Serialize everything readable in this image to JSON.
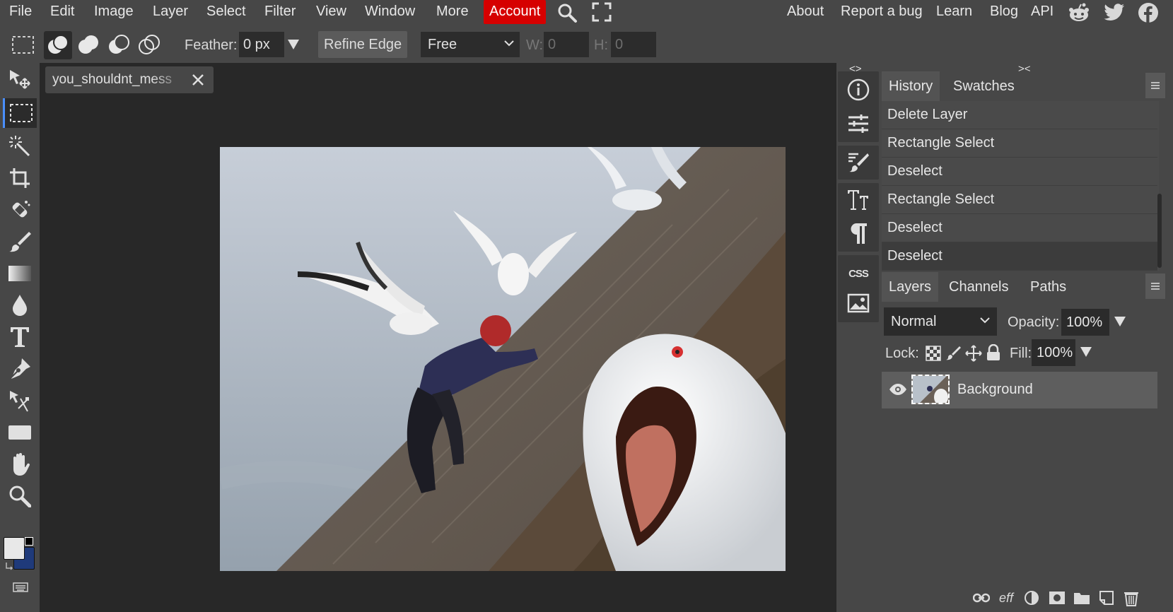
{
  "menu": {
    "items": [
      "File",
      "Edit",
      "Image",
      "Layer",
      "Select",
      "Filter",
      "View",
      "Window",
      "More"
    ],
    "account": "Account",
    "right_links": [
      "About",
      "Report a bug",
      "Learn",
      "Blog",
      "API"
    ],
    "icons": [
      "search-icon",
      "fullscreen-icon",
      "reddit-icon",
      "twitter-icon",
      "facebook-icon"
    ],
    "account_color": "#d60000"
  },
  "options": {
    "feather_label": "Feather:",
    "feather_value": "0 px",
    "refine_edge": "Refine Edge",
    "mode_value": "Free",
    "w_label": "W:",
    "w_value": "0",
    "h_label": "H:",
    "h_value": "0"
  },
  "toolbox": {
    "tools": [
      "move-tool",
      "rectangle-select-tool",
      "magic-wand-tool",
      "crop-tool",
      "healing-tool",
      "brush-tool",
      "gradient-tool",
      "blur-tool",
      "type-tool",
      "pen-tool",
      "path-select-tool",
      "shape-tool",
      "hand-tool",
      "zoom-tool"
    ],
    "active_tool": "rectangle-select-tool",
    "foreground_color": "#e8e8e8",
    "background_color": "#1f3a7a"
  },
  "document": {
    "tab_label": "you_shouldnt_mess"
  },
  "panelstrip": {
    "collapse_left": "<>",
    "collapse_right": "><",
    "css_label": "CSS"
  },
  "history": {
    "tabs": [
      "History",
      "Swatches"
    ],
    "items": [
      "Delete Layer",
      "Rectangle Select",
      "Deselect",
      "Rectangle Select",
      "Deselect",
      "Deselect"
    ]
  },
  "layers": {
    "tabs": [
      "Layers",
      "Channels",
      "Paths"
    ],
    "blend_mode": "Normal",
    "opacity_label": "Opacity:",
    "opacity_value": "100%",
    "lock_label": "Lock:",
    "fill_label": "Fill:",
    "fill_value": "100%",
    "layer_name": "Background",
    "footer_icons": [
      "link-icon",
      "effects-icon",
      "adjustment-icon",
      "mask-icon",
      "folder-icon",
      "new-layer-icon",
      "trash-icon"
    ],
    "effects_label": "eff"
  }
}
